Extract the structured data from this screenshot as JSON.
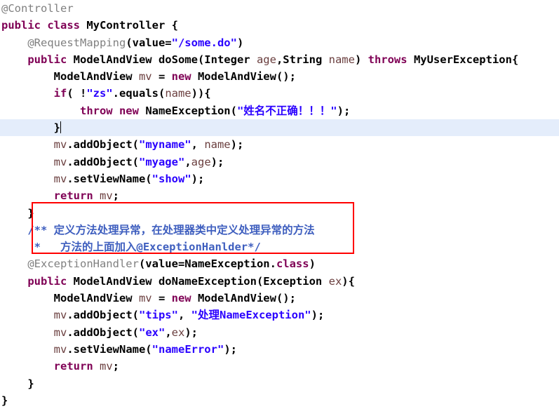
{
  "editor": {
    "language": "java",
    "background_color": "#ffffff",
    "highlight_color": "#e4edfb",
    "annotation_box_color": "#ff0000",
    "colors": {
      "keyword": "#7f0055",
      "annotation": "#808080",
      "string": "#2a00ff",
      "comment": "#3f5fbf",
      "parameter": "#6a3e3e",
      "field": "#0000c0",
      "plain": "#000000"
    }
  },
  "lines": [
    {
      "n": 1,
      "text": "@Controller"
    },
    {
      "n": 2,
      "text": "public class MyController {"
    },
    {
      "n": 3,
      "text": "    @RequestMapping(value=\"/some.do\")"
    },
    {
      "n": 4,
      "text": "    public ModelAndView doSome(Integer age,String name) throws MyUserException{"
    },
    {
      "n": 5,
      "text": "        ModelAndView mv = new ModelAndView();"
    },
    {
      "n": 6,
      "text": "        if( !\"zs\".equals(name)){"
    },
    {
      "n": 7,
      "text": "            throw new NameException(\"姓名不正确！！！\");"
    },
    {
      "n": 8,
      "text": "        }",
      "highlighted": true,
      "caret": true
    },
    {
      "n": 9,
      "text": "        mv.addObject(\"myname\", name);"
    },
    {
      "n": 10,
      "text": "        mv.addObject(\"myage\",age);"
    },
    {
      "n": 11,
      "text": "        mv.setViewName(\"show\");"
    },
    {
      "n": 12,
      "text": "        return mv;"
    },
    {
      "n": 13,
      "text": "    }"
    },
    {
      "n": 14,
      "text": "    /** 定义方法处理异常，在处理器类中定义处理异常的方法"
    },
    {
      "n": 15,
      "text": "     *   方法的上面加入@ExceptionHanlder*/"
    },
    {
      "n": 16,
      "text": "    @ExceptionHandler(value=NameException.class)"
    },
    {
      "n": 17,
      "text": "    public ModelAndView doNameException(Exception ex){"
    },
    {
      "n": 18,
      "text": "        ModelAndView mv = new ModelAndView();"
    },
    {
      "n": 19,
      "text": "        mv.addObject(\"tips\", \"处理NameException\");"
    },
    {
      "n": 20,
      "text": "        mv.addObject(\"ex\",ex);"
    },
    {
      "n": 21,
      "text": "        mv.setViewName(\"nameError\");"
    },
    {
      "n": 22,
      "text": "        return mv;"
    },
    {
      "n": 23,
      "text": "    }"
    },
    {
      "n": 24,
      "text": "}"
    }
  ],
  "tokens": {
    "l1": [
      {
        "t": "@Controller",
        "c": "ann"
      }
    ],
    "l2": [
      {
        "t": "public class ",
        "c": "kw"
      },
      {
        "t": "MyController {",
        "c": "plain"
      }
    ],
    "l3": [
      {
        "t": "    ",
        "c": "plain"
      },
      {
        "t": "@RequestMapping",
        "c": "ann"
      },
      {
        "t": "(value=",
        "c": "plain"
      },
      {
        "t": "\"/some.do\"",
        "c": "str"
      },
      {
        "t": ")",
        "c": "plain"
      }
    ],
    "l4": [
      {
        "t": "    ",
        "c": "plain"
      },
      {
        "t": "public ",
        "c": "kw"
      },
      {
        "t": "ModelAndView doSome(Integer ",
        "c": "plain"
      },
      {
        "t": "age",
        "c": "var"
      },
      {
        "t": ",String ",
        "c": "plain"
      },
      {
        "t": "name",
        "c": "var"
      },
      {
        "t": ") ",
        "c": "plain"
      },
      {
        "t": "throws ",
        "c": "kw"
      },
      {
        "t": "MyUserException{",
        "c": "plain"
      }
    ],
    "l5": [
      {
        "t": "        ModelAndView ",
        "c": "plain"
      },
      {
        "t": "mv",
        "c": "var"
      },
      {
        "t": " = ",
        "c": "plain"
      },
      {
        "t": "new ",
        "c": "kw"
      },
      {
        "t": "ModelAndView();",
        "c": "plain"
      }
    ],
    "l6": [
      {
        "t": "        ",
        "c": "plain"
      },
      {
        "t": "if",
        "c": "kw"
      },
      {
        "t": "( !",
        "c": "plain"
      },
      {
        "t": "\"zs\"",
        "c": "str"
      },
      {
        "t": ".equals(",
        "c": "plain"
      },
      {
        "t": "name",
        "c": "var"
      },
      {
        "t": ")){",
        "c": "plain"
      }
    ],
    "l7": [
      {
        "t": "            ",
        "c": "plain"
      },
      {
        "t": "throw new ",
        "c": "kw"
      },
      {
        "t": "NameException(",
        "c": "plain"
      },
      {
        "t": "\"姓名不正确！！！\"",
        "c": "str"
      },
      {
        "t": ");",
        "c": "plain"
      }
    ],
    "l8": [
      {
        "t": "        }",
        "c": "plain"
      }
    ],
    "l9": [
      {
        "t": "        ",
        "c": "plain"
      },
      {
        "t": "mv",
        "c": "var"
      },
      {
        "t": ".addObject(",
        "c": "plain"
      },
      {
        "t": "\"myname\"",
        "c": "str"
      },
      {
        "t": ", ",
        "c": "plain"
      },
      {
        "t": "name",
        "c": "var"
      },
      {
        "t": ");",
        "c": "plain"
      }
    ],
    "l10": [
      {
        "t": "        ",
        "c": "plain"
      },
      {
        "t": "mv",
        "c": "var"
      },
      {
        "t": ".addObject(",
        "c": "plain"
      },
      {
        "t": "\"myage\"",
        "c": "str"
      },
      {
        "t": ",",
        "c": "plain"
      },
      {
        "t": "age",
        "c": "var"
      },
      {
        "t": ");",
        "c": "plain"
      }
    ],
    "l11": [
      {
        "t": "        ",
        "c": "plain"
      },
      {
        "t": "mv",
        "c": "var"
      },
      {
        "t": ".setViewName(",
        "c": "plain"
      },
      {
        "t": "\"show\"",
        "c": "str"
      },
      {
        "t": ");",
        "c": "plain"
      }
    ],
    "l12": [
      {
        "t": "        ",
        "c": "plain"
      },
      {
        "t": "return ",
        "c": "kw"
      },
      {
        "t": "mv",
        "c": "var"
      },
      {
        "t": ";",
        "c": "plain"
      }
    ],
    "l13": [
      {
        "t": "    }",
        "c": "plain"
      }
    ],
    "l14": [
      {
        "t": "    ",
        "c": "plain"
      },
      {
        "t": "/** 定义方法处理异常，在处理器类中定义处理异常的方法",
        "c": "cmt"
      }
    ],
    "l15": [
      {
        "t": "    ",
        "c": "plain"
      },
      {
        "t": " *   方法的上面加入@ExceptionHanlder*/",
        "c": "cmt"
      }
    ],
    "l16": [
      {
        "t": "    ",
        "c": "plain"
      },
      {
        "t": "@ExceptionHandler",
        "c": "ann"
      },
      {
        "t": "(value=NameException.",
        "c": "plain"
      },
      {
        "t": "class",
        "c": "kw"
      },
      {
        "t": ")",
        "c": "plain"
      }
    ],
    "l17": [
      {
        "t": "    ",
        "c": "plain"
      },
      {
        "t": "public ",
        "c": "kw"
      },
      {
        "t": "ModelAndView doNameException(Exception ",
        "c": "plain"
      },
      {
        "t": "ex",
        "c": "var"
      },
      {
        "t": "){",
        "c": "plain"
      }
    ],
    "l18": [
      {
        "t": "        ModelAndView ",
        "c": "plain"
      },
      {
        "t": "mv",
        "c": "var"
      },
      {
        "t": " = ",
        "c": "plain"
      },
      {
        "t": "new ",
        "c": "kw"
      },
      {
        "t": "ModelAndView();",
        "c": "plain"
      }
    ],
    "l19": [
      {
        "t": "        ",
        "c": "plain"
      },
      {
        "t": "mv",
        "c": "var"
      },
      {
        "t": ".addObject(",
        "c": "plain"
      },
      {
        "t": "\"tips\"",
        "c": "str"
      },
      {
        "t": ", ",
        "c": "plain"
      },
      {
        "t": "\"处理NameException\"",
        "c": "str"
      },
      {
        "t": ");",
        "c": "plain"
      }
    ],
    "l20": [
      {
        "t": "        ",
        "c": "plain"
      },
      {
        "t": "mv",
        "c": "var"
      },
      {
        "t": ".addObject(",
        "c": "plain"
      },
      {
        "t": "\"ex\"",
        "c": "str"
      },
      {
        "t": ",",
        "c": "plain"
      },
      {
        "t": "ex",
        "c": "var"
      },
      {
        "t": ");",
        "c": "plain"
      }
    ],
    "l21": [
      {
        "t": "        ",
        "c": "plain"
      },
      {
        "t": "mv",
        "c": "var"
      },
      {
        "t": ".setViewName(",
        "c": "plain"
      },
      {
        "t": "\"nameError\"",
        "c": "str"
      },
      {
        "t": ");",
        "c": "plain"
      }
    ],
    "l22": [
      {
        "t": "        ",
        "c": "plain"
      },
      {
        "t": "return ",
        "c": "kw"
      },
      {
        "t": "mv",
        "c": "var"
      },
      {
        "t": ";",
        "c": "plain"
      }
    ],
    "l23": [
      {
        "t": "    }",
        "c": "plain"
      }
    ],
    "l24": [
      {
        "t": "}",
        "c": "plain"
      }
    ]
  }
}
